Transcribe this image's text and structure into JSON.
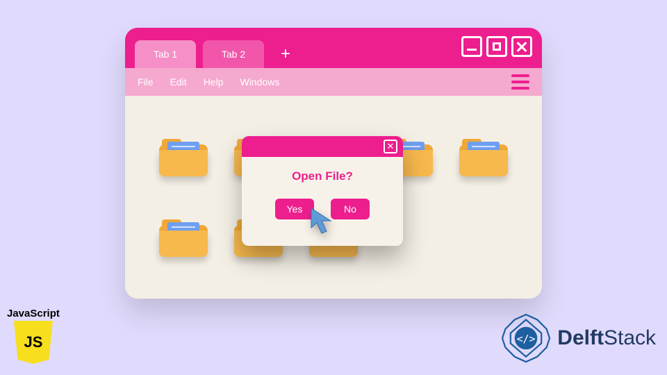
{
  "window": {
    "tabs": [
      {
        "label": "Tab 1",
        "active": true
      },
      {
        "label": "Tab 2",
        "active": false
      }
    ],
    "new_tab_glyph": "+",
    "controls": {
      "minimize": "–",
      "maximize": "□",
      "close": "✕"
    },
    "menu": {
      "items": [
        "File",
        "Edit",
        "Help",
        "Windows"
      ]
    },
    "folders": [
      true,
      true,
      false,
      true,
      true,
      true,
      true,
      true,
      false,
      false
    ]
  },
  "dialog": {
    "title": "Open File?",
    "yes_label": "Yes",
    "no_label": "No",
    "close_glyph": "✕"
  },
  "badges": {
    "js_label": "JavaScript",
    "js_glyph": "JS",
    "brand": "DelftStack"
  },
  "palette": {
    "accent": "#ed1e8e",
    "bg": "#e0dafc"
  }
}
